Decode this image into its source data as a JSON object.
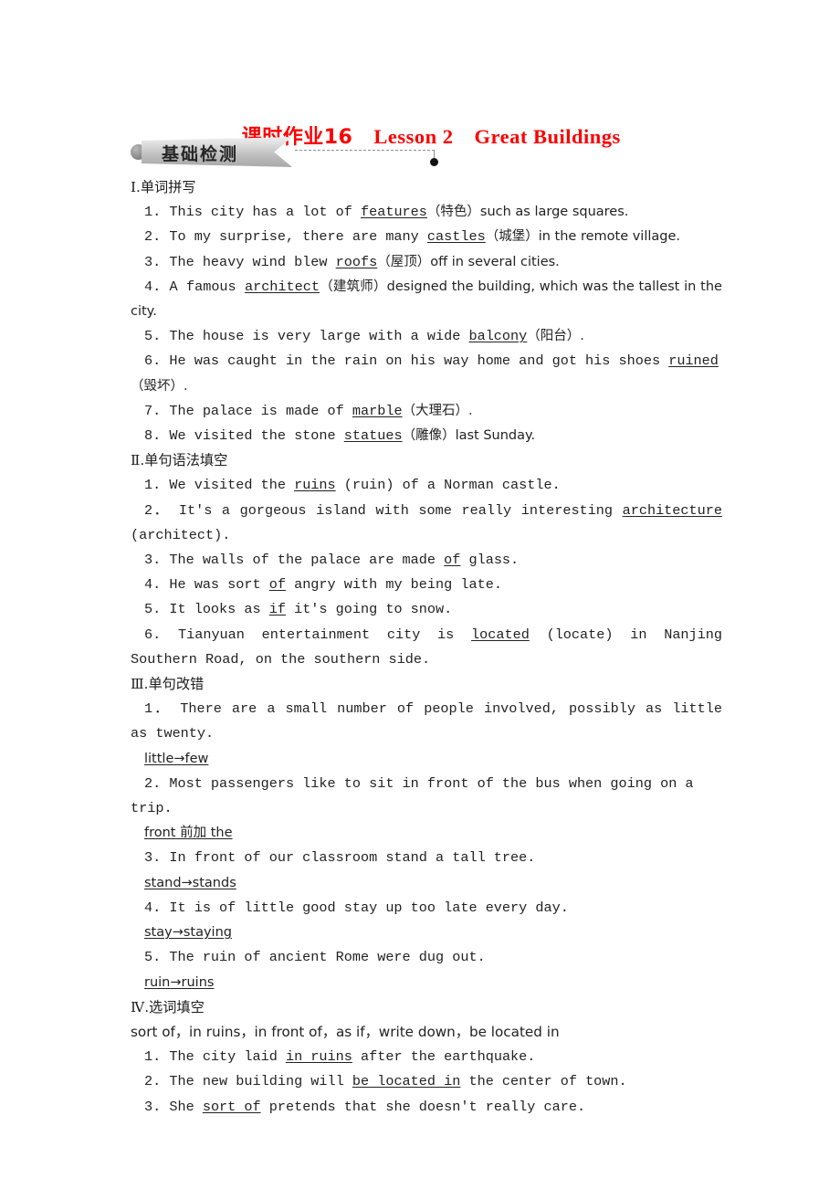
{
  "document": {
    "title_cn": "课时作业16",
    "title_en": "Lesson 2　Great Buildings",
    "title_full": "课时作业16　Lesson 2　Great Buildings",
    "title_color": "#fb0000",
    "banner_label": "基础检测"
  },
  "sections": [
    {
      "id": "section-1",
      "heading": "Ⅰ.单词拼写",
      "heading_roman": "Ⅰ",
      "heading_cn": ".单词拼写",
      "items": [
        {
          "num": "1.",
          "pre": "This city has a lot of ",
          "answer": "features",
          "post": "（特色）such as large squares."
        },
        {
          "num": "2.",
          "pre": "To my surprise, there are many ",
          "answer": "castles",
          "post": "（城堡）in the remote village."
        },
        {
          "num": "3.",
          "pre": "The heavy wind blew ",
          "answer": "roofs",
          "post": "（屋顶）off in several cities."
        },
        {
          "num": "4.",
          "pre": "A famous ",
          "answer": "architect",
          "post": "（建筑师）designed the building, which was the tallest in the city.",
          "justified": true
        },
        {
          "num": "5.",
          "pre": "The house is very large with a wide ",
          "answer": "balcony",
          "post": "（阳台）."
        },
        {
          "num": "6.",
          "pre": "He was caught in the rain on his way home and got his shoes ",
          "answer": "ruined",
          "post": "（毁坏）."
        },
        {
          "num": "7.",
          "pre": "The palace is made of ",
          "answer": "marble",
          "post": "（大理石）."
        },
        {
          "num": "8.",
          "pre": "We visited the stone ",
          "answer": "statues",
          "post": "（雕像）last Sunday."
        }
      ]
    },
    {
      "id": "section-2",
      "heading": "Ⅱ.单句语法填空",
      "heading_roman": "Ⅱ",
      "heading_cn": ".单句语法填空",
      "items": [
        {
          "num": "1.",
          "pre": "We visited the ",
          "answer": "ruins",
          "post": " (ruin) of a Norman castle."
        },
        {
          "num": "2．",
          "pre": "It's a gorgeous island with some really interesting ",
          "answer": "architecture",
          "post": " (architect).",
          "justified": true
        },
        {
          "num": "3.",
          "pre": "The walls of the palace are made ",
          "answer": "of",
          "post": " glass."
        },
        {
          "num": "4.",
          "pre": "He was sort ",
          "answer": "of",
          "post": " angry with my being late."
        },
        {
          "num": "5.",
          "pre": "It looks as ",
          "answer": "if",
          "post": " it's going to snow."
        },
        {
          "num": "6.",
          "pre": "Tianyuan entertainment city is ",
          "answer": "located",
          "post": " (locate) in Nanjing Southern Road, on the southern side.",
          "justified": true
        }
      ]
    },
    {
      "id": "section-3",
      "heading": "Ⅲ.单句改错",
      "heading_roman": "Ⅲ",
      "heading_cn": ".单句改错",
      "items": [
        {
          "num": "1．",
          "sentence": "There are a small number of people involved, possibly as little as twenty.",
          "correction": "little→few",
          "justified": true
        },
        {
          "num": "2.",
          "sentence": "Most passengers like to sit in front of the bus when going on a trip.",
          "correction": "front 前加 the"
        },
        {
          "num": "3.",
          "sentence": "In front of our classroom stand a tall tree.",
          "correction": "stand→stands"
        },
        {
          "num": "4.",
          "sentence": "It is of little good stay up too late every day.",
          "correction": "stay→staying"
        },
        {
          "num": "5.",
          "sentence": "The ruin of ancient Rome were dug out.",
          "correction": "ruin→ruins"
        }
      ]
    },
    {
      "id": "section-4",
      "heading": "Ⅳ.选词填空",
      "heading_roman": "Ⅳ",
      "heading_cn": ".选词填空",
      "word_bank": "sort of，in ruins，in front of，as if，write down，be located in",
      "items": [
        {
          "num": "1.",
          "pre": "The city laid ",
          "answer": "in ruins",
          "post": " after the earthquake."
        },
        {
          "num": "2.",
          "pre": "The new building will ",
          "answer": "be located in",
          "post": " the center of town."
        },
        {
          "num": "3.",
          "pre": "She ",
          "answer": "sort of",
          "post": " pretends that she doesn't really care."
        }
      ]
    }
  ]
}
